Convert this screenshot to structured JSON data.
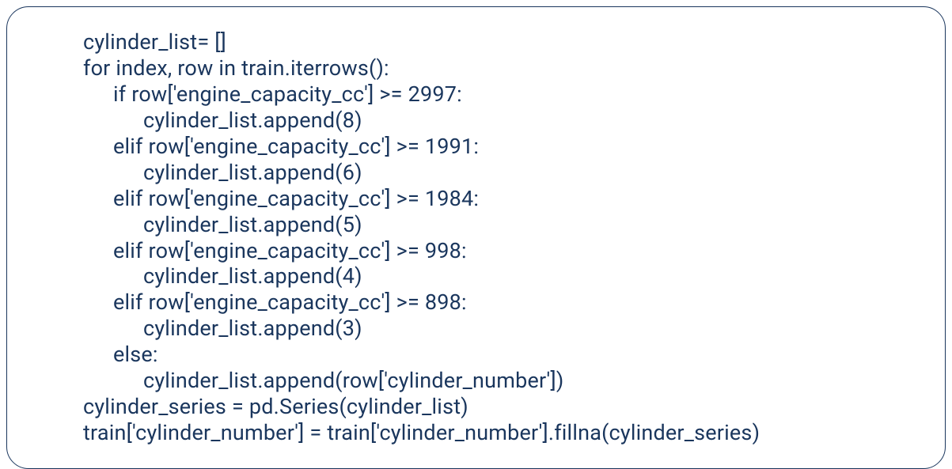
{
  "code": {
    "lines": [
      {
        "indent": 0,
        "text": "cylinder_list= []"
      },
      {
        "indent": 0,
        "text": "for index, row in train.iterrows():"
      },
      {
        "indent": 1,
        "text": "if row['engine_capacity_cc'] >= 2997:"
      },
      {
        "indent": 2,
        "text": "cylinder_list.append(8)"
      },
      {
        "indent": 1,
        "text": "elif row['engine_capacity_cc'] >= 1991:"
      },
      {
        "indent": 2,
        "text": "cylinder_list.append(6)"
      },
      {
        "indent": 1,
        "text": "elif row['engine_capacity_cc'] >= 1984:"
      },
      {
        "indent": 2,
        "text": "cylinder_list.append(5)"
      },
      {
        "indent": 1,
        "text": "elif row['engine_capacity_cc'] >= 998:"
      },
      {
        "indent": 2,
        "text": "cylinder_list.append(4)"
      },
      {
        "indent": 1,
        "text": "elif row['engine_capacity_cc'] >= 898:"
      },
      {
        "indent": 2,
        "text": "cylinder_list.append(3)"
      },
      {
        "indent": 1,
        "text": "else:"
      },
      {
        "indent": 2,
        "text": "cylinder_list.append(row['cylinder_number'])"
      },
      {
        "indent": 0,
        "text": "cylinder_series = pd.Series(cylinder_list)"
      },
      {
        "indent": 0,
        "text": "train['cylinder_number'] = train['cylinder_number'].fillna(cylinder_series)"
      }
    ]
  },
  "colors": {
    "border": "#1a365d",
    "text": "#1a365d",
    "background": "#ffffff"
  }
}
